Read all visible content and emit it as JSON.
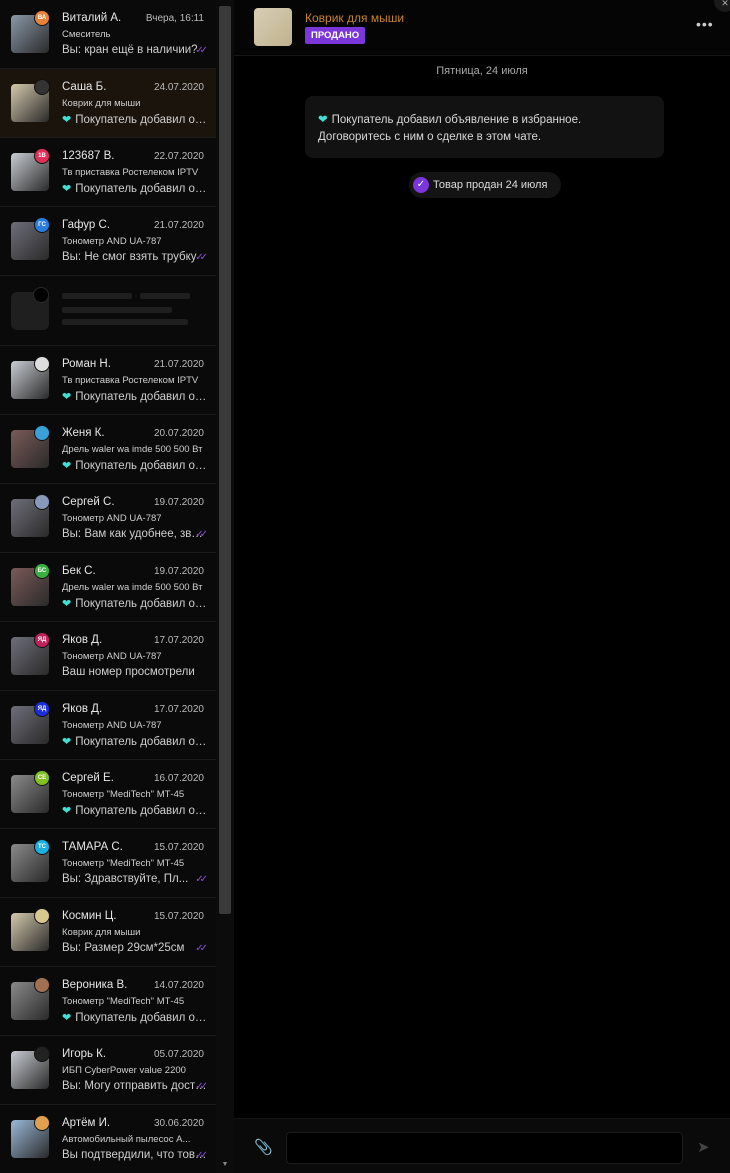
{
  "header": {
    "title": "Коврик для мыши",
    "badge": "ПРОДАНО",
    "more_icon": "more-icon"
  },
  "conversation": {
    "day_label": "Пятница, 24 июля",
    "system_message": {
      "line1": "Покупатель добавил объявление в избранное.",
      "line2": "Договоритесь с ним о сделке в этом чате."
    },
    "sold_notice": "Товар продан 24 июля"
  },
  "composer": {
    "placeholder": "",
    "attach_icon": "paperclip-icon",
    "send_icon": "send-icon"
  },
  "colors": {
    "accent": "#7a36d9",
    "title": "#c8842c",
    "heart": "#3ee0d8"
  },
  "chats": [
    {
      "name": "Виталий А.",
      "date": "Вчера, 16:11",
      "item": "Смеситель",
      "message": "Вы: кран ещё в наличии?",
      "heart": false,
      "read": true,
      "avatar_text": "ВА",
      "avatar_color": "#e8823a",
      "thumb": "#8a98a8",
      "active": false
    },
    {
      "name": "Саша Б.",
      "date": "24.07.2020",
      "item": "Коврик для мыши",
      "message": "Покупатель добавил объявление",
      "heart": true,
      "read": false,
      "avatar_text": "",
      "avatar_color": "#333333",
      "thumb": "#d4c9ac",
      "active": true
    },
    {
      "name": "123687 В.",
      "date": "22.07.2020",
      "item": "Тв приставка Ростелеком IPTV",
      "message": "Покупатель добавил объявление",
      "heart": true,
      "read": false,
      "avatar_text": "1В",
      "avatar_color": "#e0305a",
      "thumb": "#c8ccd2",
      "active": false
    },
    {
      "name": "Гафур С.",
      "date": "21.07.2020",
      "item": "Тонометр AND UA-787",
      "message": "Вы: Не смог взять трубку",
      "heart": false,
      "read": true,
      "avatar_text": "ГС",
      "avatar_color": "#2a7de0",
      "thumb": "#6e6e78",
      "active": false
    },
    {
      "name": "Роман Н.",
      "date": "21.07.2020",
      "item": "Тв приставка Ростелеком IPTV",
      "message": "Покупатель добавил объявление",
      "heart": true,
      "read": false,
      "avatar_text": "",
      "avatar_color": "#dddddd",
      "thumb": "#c8ccd2",
      "active": false
    },
    {
      "name": "Женя К.",
      "date": "20.07.2020",
      "item": "Дрель waler wa imde 500 500 Вт",
      "message": "Покупатель добавил объявление",
      "heart": true,
      "read": false,
      "avatar_text": "",
      "avatar_color": "#3aa0d8",
      "thumb": "#7a5a58",
      "active": false
    },
    {
      "name": "Сергей С.",
      "date": "19.07.2020",
      "item": "Тонометр AND UA-787",
      "message": "Вы: Вам как удобнее, звонком?",
      "heart": false,
      "read": true,
      "avatar_text": "",
      "avatar_color": "#8899bb",
      "thumb": "#6e6e78",
      "active": false
    },
    {
      "name": "Бек С.",
      "date": "19.07.2020",
      "item": "Дрель waler wa imde 500 500 Вт",
      "message": "Покупатель добавил объявление",
      "heart": true,
      "read": false,
      "avatar_text": "БС",
      "avatar_color": "#3ab040",
      "thumb": "#7a5a58",
      "active": false
    },
    {
      "name": "Яков Д.",
      "date": "17.07.2020",
      "item": "Тонометр AND UA-787",
      "message": "Ваш номер просмотрели",
      "heart": false,
      "read": false,
      "avatar_text": "ЯД",
      "avatar_color": "#c0205a",
      "thumb": "#6e6e78",
      "active": false
    },
    {
      "name": "Яков Д.",
      "date": "17.07.2020",
      "item": "Тонометр AND UA-787",
      "message": "Покупатель добавил объявление",
      "heart": true,
      "read": false,
      "avatar_text": "ЯД",
      "avatar_color": "#1a2ee0",
      "thumb": "#6e6e78",
      "active": false
    },
    {
      "name": "Сергей Е.",
      "date": "16.07.2020",
      "item": "Тонометр \"MediTech\" МТ-45",
      "message": "Покупатель добавил объявление",
      "heart": true,
      "read": false,
      "avatar_text": "СЕ",
      "avatar_color": "#80c020",
      "thumb": "#8a8a8a",
      "active": false
    },
    {
      "name": "ТАМАРА С.",
      "date": "15.07.2020",
      "item": "Тонометр \"MediTech\" МТ-45",
      "message": "Вы: Здравствуйте, Пл...",
      "heart": false,
      "read": true,
      "avatar_text": "ТС",
      "avatar_color": "#1ab0e0",
      "thumb": "#8a8a8a",
      "active": false
    },
    {
      "name": "Космин Ц.",
      "date": "15.07.2020",
      "item": "Коврик для мыши",
      "message": "Вы: Размер 29см*25см",
      "heart": false,
      "read": true,
      "avatar_text": "",
      "avatar_color": "#d8c890",
      "thumb": "#d4c9ac",
      "active": false
    },
    {
      "name": "Вероника В.",
      "date": "14.07.2020",
      "item": "Тонометр \"MediTech\" МТ-45",
      "message": "Покупатель добавил объявление",
      "heart": true,
      "read": false,
      "avatar_text": "",
      "avatar_color": "#a07050",
      "thumb": "#8a8a8a",
      "active": false
    },
    {
      "name": "Игорь К.",
      "date": "05.07.2020",
      "item": "ИБП CyberPower value 2200",
      "message": "Вы: Могу отправить доставкой",
      "heart": false,
      "read": true,
      "avatar_text": "",
      "avatar_color": "#222222",
      "thumb": "#c8ccd2",
      "active": false
    },
    {
      "name": "Артём И.",
      "date": "30.06.2020",
      "item": "Автомобильный пылесос А...",
      "message": "Вы подтвердили, что товар",
      "heart": false,
      "read": true,
      "avatar_text": "",
      "avatar_color": "#e0a050",
      "thumb": "#9ab8d8",
      "active": false
    }
  ]
}
